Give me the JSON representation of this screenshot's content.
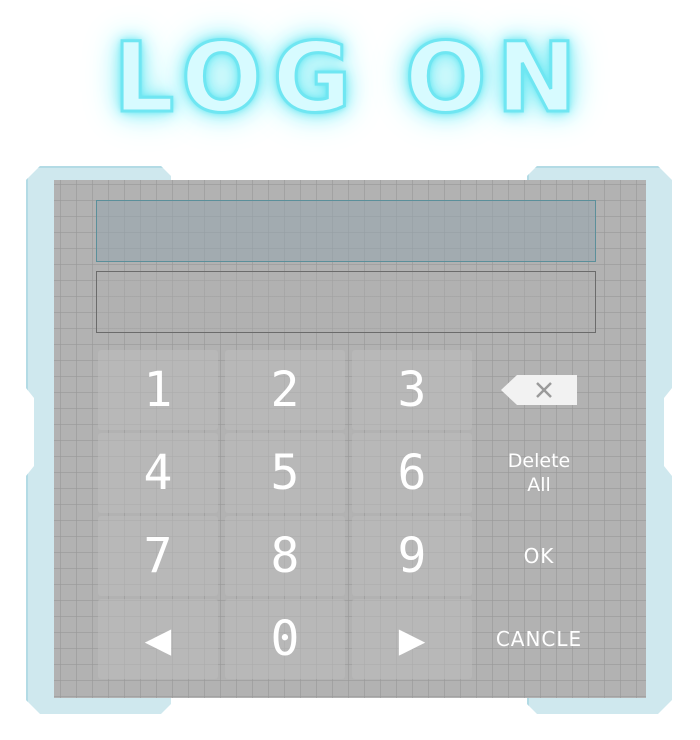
{
  "title": "LOG ON",
  "display": {
    "value": "",
    "secondary_value": ""
  },
  "keypad": {
    "keys": [
      {
        "label": "1"
      },
      {
        "label": "2"
      },
      {
        "label": "3"
      },
      {
        "label": "4"
      },
      {
        "label": "5"
      },
      {
        "label": "6"
      },
      {
        "label": "7"
      },
      {
        "label": "8"
      },
      {
        "label": "9"
      },
      {
        "label": "◀"
      },
      {
        "label": "0"
      },
      {
        "label": "▶"
      }
    ],
    "backspace_icon": "backspace-icon",
    "delete_all": "Delete\nAll",
    "ok": "OK",
    "cancel": "CANCLE"
  },
  "colors": {
    "title_glow": "#6fe6f2",
    "panel": "#b2b2b2",
    "frame": "#cfe8ee",
    "display_border": "#5b8f9a"
  }
}
